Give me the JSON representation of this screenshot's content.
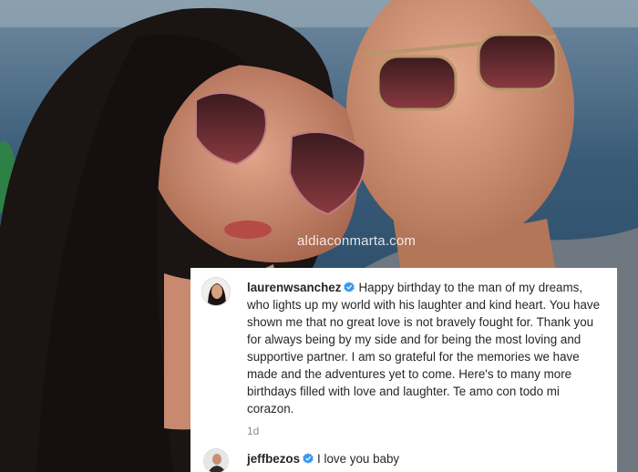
{
  "watermark": "aldiaconmarta.com",
  "comments": [
    {
      "username": "laurenwsanchez",
      "text": "Happy birthday to the man of my dreams, who lights up my world with his laughter and kind heart. You have shown me that no great love is not bravely fought for. Thank you for always being by my side and for being the most loving and supportive partner. I am so grateful for the memories we have made and the adventures yet to come. Here's to many more birthdays filled with love and laughter. Te amo con todo mi corazon.",
      "time": "1d"
    },
    {
      "username": "jeffbezos",
      "text": "I love you baby"
    }
  ],
  "colors": {
    "verified": "#3897f0",
    "username": "#262626",
    "meta": "#8e8e8e"
  },
  "icons": [
    "verified-badge-icon",
    "avatar-laurenwsanchez",
    "avatar-jeffbezos"
  ]
}
